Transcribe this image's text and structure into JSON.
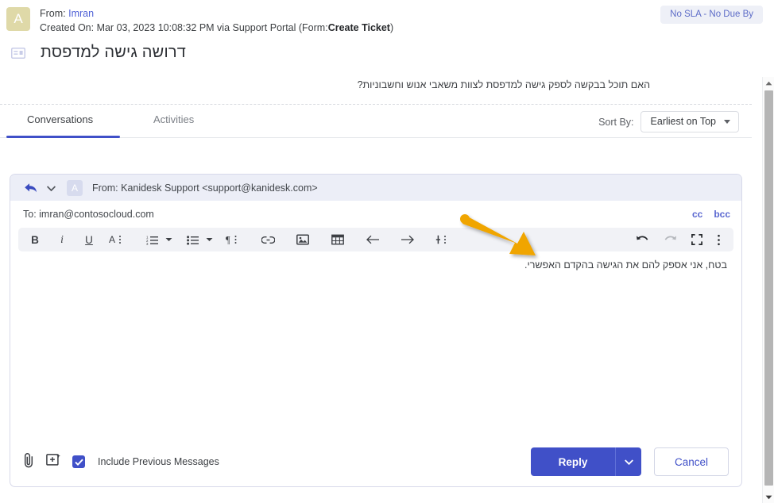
{
  "header": {
    "avatar_initial": "A",
    "from_label": "From:",
    "from_name": "Imran",
    "created_prefix": "Created On: Mar 03, 2023 10:08:32 PM via Support Portal (Form:",
    "created_form": "Create Ticket",
    "created_suffix": ")",
    "sla_badge": "No SLA - No Due By",
    "subject": "דרושה גישה למדפסת",
    "ticket_icon": "ticket-icon"
  },
  "original_message": {
    "text": "האם תוכל בבקשה לספק גישה למדפסת לצוות משאבי אנוש וחשבוניות?"
  },
  "tabs": {
    "items": [
      {
        "label": "Conversations",
        "active": true
      },
      {
        "label": "Activities",
        "active": false
      }
    ],
    "sort": {
      "label": "Sort By:",
      "value": "Earliest on Top",
      "icon": "chevron-down-icon"
    }
  },
  "composer": {
    "reply_icon": "reply-arrow-icon",
    "head_caret_icon": "chevron-down-icon",
    "head_avatar_initial": "A",
    "from_line": "From:  Kanidesk Support <support@kanidesk.com>",
    "to_line": "To: imran@contosocloud.com",
    "cc_label": "cc",
    "bcc_label": "bcc",
    "toolbar": [
      {
        "name": "bold-icon",
        "glyph": "B"
      },
      {
        "name": "italic-icon",
        "glyph": "i"
      },
      {
        "name": "underline-icon",
        "glyph": "U"
      },
      {
        "name": "font-color-icon",
        "glyph": "A"
      },
      {
        "name": "ordered-list-icon",
        "glyph": "list"
      },
      {
        "name": "ordered-list-dropdown-icon",
        "glyph": "caret"
      },
      {
        "name": "unordered-list-icon",
        "glyph": "list"
      },
      {
        "name": "unordered-list-dropdown-icon",
        "glyph": "caret"
      },
      {
        "name": "paragraph-direction-icon",
        "glyph": "pilcrow"
      },
      {
        "name": "insert-link-icon",
        "glyph": "link"
      },
      {
        "name": "insert-image-icon",
        "glyph": "image"
      },
      {
        "name": "insert-table-icon",
        "glyph": "table"
      },
      {
        "name": "outdent-icon",
        "glyph": "arrow-left"
      },
      {
        "name": "indent-icon",
        "glyph": "arrow-right"
      },
      {
        "name": "insert-more-icon",
        "glyph": "plus"
      }
    ],
    "toolbar_right": [
      {
        "name": "undo-icon",
        "enabled": true
      },
      {
        "name": "redo-icon",
        "enabled": false
      },
      {
        "name": "fullscreen-icon",
        "enabled": true
      },
      {
        "name": "editor-more-options-icon",
        "enabled": true
      }
    ],
    "body_text": "בטח, אני אספק להם את הגישה בהקדם האפשרי.",
    "footer": {
      "attach_icon": "paperclip-icon",
      "insert_template_icon": "insert-template-icon",
      "checkbox_checked": true,
      "checkbox_label": "Include Previous Messages",
      "reply_button": "Reply",
      "reply_dropdown_icon": "chevron-down-icon",
      "cancel_button": "Cancel"
    }
  },
  "scrollbar": {
    "up_icon": "scroll-up-arrow-icon",
    "down_icon": "scroll-down-arrow-icon"
  },
  "annotation": {
    "type": "pointer-arrow",
    "color": "#f0a500"
  },
  "colors": {
    "accent": "#4050c8",
    "link": "#5a67d0",
    "badge_bg": "#eef0f7",
    "annotation": "#f0a500"
  }
}
